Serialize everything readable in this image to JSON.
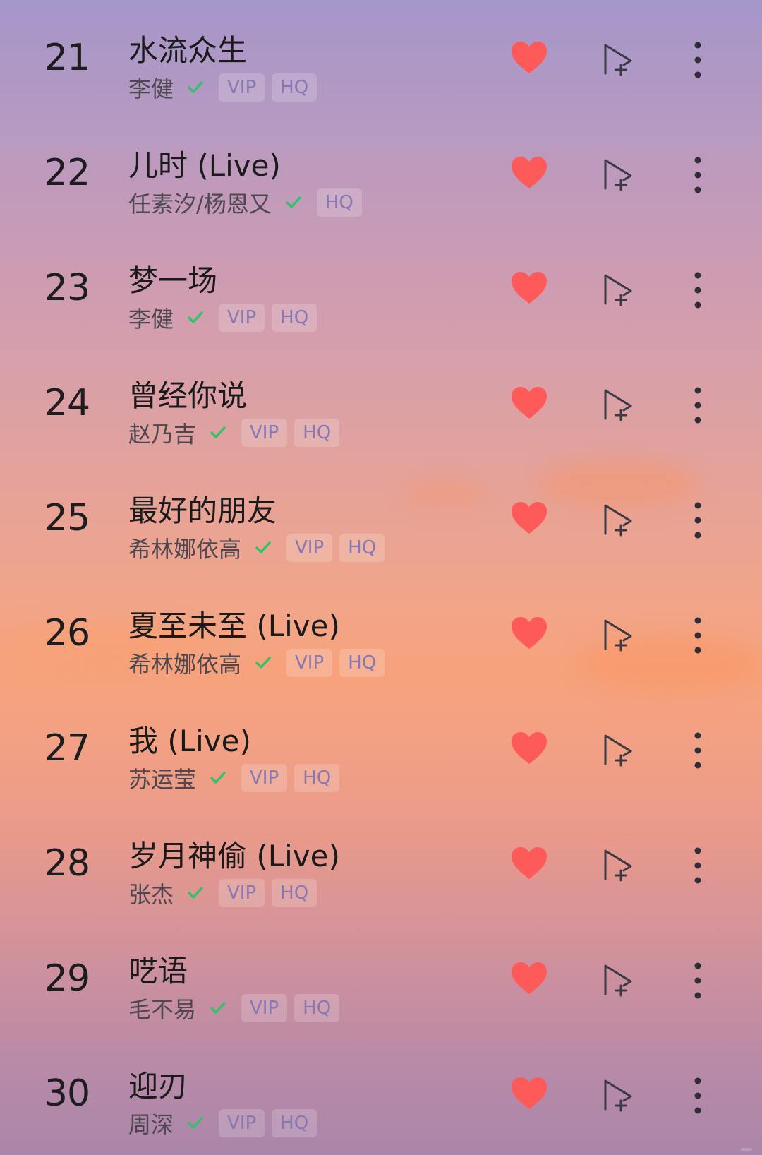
{
  "colors": {
    "heart": "#ff5a5a",
    "check": "#33c26b",
    "tag_text": "#8778b4",
    "rank_text": "#1d1d1f"
  },
  "icons": {
    "like": "heart-icon",
    "add_to_queue": "add-to-playlist-icon",
    "more": "more-vertical-icon",
    "verified": "check-icon"
  },
  "songs": [
    {
      "rank": "21",
      "title": "水流众生",
      "artist": "李健",
      "tags": [
        "VIP",
        "HQ"
      ]
    },
    {
      "rank": "22",
      "title": "儿时 (Live)",
      "artist": "任素汐/杨恩又",
      "tags": [
        "HQ"
      ]
    },
    {
      "rank": "23",
      "title": "梦一场",
      "artist": "李健",
      "tags": [
        "VIP",
        "HQ"
      ]
    },
    {
      "rank": "24",
      "title": "曾经你说",
      "artist": "赵乃吉",
      "tags": [
        "VIP",
        "HQ"
      ]
    },
    {
      "rank": "25",
      "title": "最好的朋友",
      "artist": "希林娜依高",
      "tags": [
        "VIP",
        "HQ"
      ]
    },
    {
      "rank": "26",
      "title": "夏至未至 (Live)",
      "artist": "希林娜依高",
      "tags": [
        "VIP",
        "HQ"
      ]
    },
    {
      "rank": "27",
      "title": "我 (Live)",
      "artist": "苏运莹",
      "tags": [
        "VIP",
        "HQ"
      ]
    },
    {
      "rank": "28",
      "title": "岁月神偷 (Live)",
      "artist": "张杰",
      "tags": [
        "VIP",
        "HQ"
      ]
    },
    {
      "rank": "29",
      "title": "呓语",
      "artist": "毛不易",
      "tags": [
        "VIP",
        "HQ"
      ]
    },
    {
      "rank": "30",
      "title": "迎刃",
      "artist": "周深",
      "tags": [
        "VIP",
        "HQ"
      ]
    }
  ]
}
